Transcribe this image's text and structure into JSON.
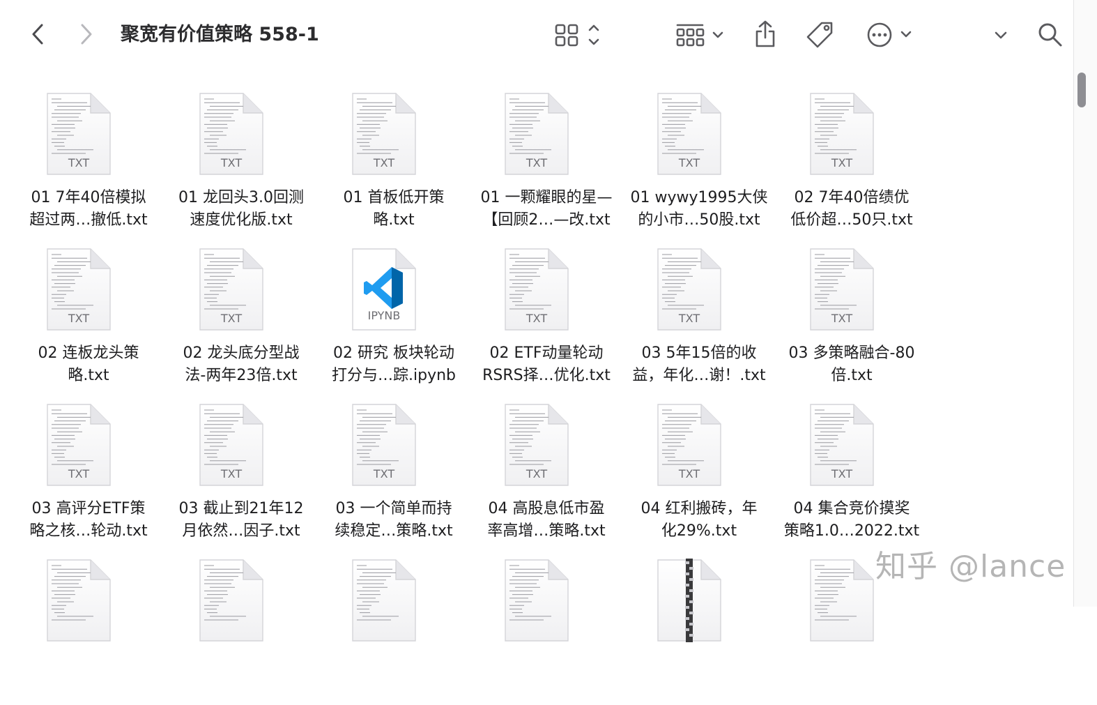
{
  "window": {
    "title": "聚宽有价值策略 558-1"
  },
  "toolbar": {
    "back_icon": "chevron-left-icon",
    "forward_icon": "chevron-right-icon",
    "view_icon": "grid-view-icon",
    "group_icon": "group-by-icon",
    "share_icon": "share-icon",
    "tag_icon": "tag-icon",
    "more_icon": "ellipsis-circle-icon",
    "search_icon": "search-icon"
  },
  "files": [
    {
      "line1": "01 7年40倍模拟",
      "line2": "超过两…撤低.txt",
      "kind": "txt",
      "ext": "TXT"
    },
    {
      "line1": "01 龙回头3.0回测",
      "line2": "速度优化版.txt",
      "kind": "txt",
      "ext": "TXT"
    },
    {
      "line1": "01 首板低开策",
      "line2": "略.txt",
      "kind": "txt",
      "ext": "TXT"
    },
    {
      "line1": "01 一颗耀眼的星—",
      "line2": "【回顾2…—改.txt",
      "kind": "txt",
      "ext": "TXT"
    },
    {
      "line1": "01 wywy1995大侠",
      "line2": "的小市…50股.txt",
      "kind": "txt",
      "ext": "TXT"
    },
    {
      "line1": "02 7年40倍绩优",
      "line2": "低价超…50只.txt",
      "kind": "txt",
      "ext": "TXT"
    },
    {
      "line1": "02 连板龙头策",
      "line2": "略.txt",
      "kind": "txt",
      "ext": "TXT"
    },
    {
      "line1": "02 龙头底分型战",
      "line2": "法-两年23倍.txt",
      "kind": "txt",
      "ext": "TXT"
    },
    {
      "line1": "02 研究 板块轮动",
      "line2": "打分与…踪.ipynb",
      "kind": "ipynb",
      "ext": "IPYNB"
    },
    {
      "line1": "02 ETF动量轮动",
      "line2": "RSRS择…优化.txt",
      "kind": "txt",
      "ext": "TXT"
    },
    {
      "line1": "03 5年15倍的收",
      "line2": "益，年化…谢！.txt",
      "kind": "txt",
      "ext": "TXT"
    },
    {
      "line1": "03 多策略融合-80",
      "line2": "倍.txt",
      "kind": "txt",
      "ext": "TXT"
    },
    {
      "line1": "03 高评分ETF策",
      "line2": "略之核…轮动.txt",
      "kind": "txt",
      "ext": "TXT"
    },
    {
      "line1": "03 截止到21年12",
      "line2": "月依然…因子.txt",
      "kind": "txt",
      "ext": "TXT"
    },
    {
      "line1": "03 一个简单而持",
      "line2": "续稳定…策略.txt",
      "kind": "txt",
      "ext": "TXT"
    },
    {
      "line1": "04 高股息低市盈",
      "line2": "率高增…策略.txt",
      "kind": "txt",
      "ext": "TXT"
    },
    {
      "line1": "04 红利搬砖，年",
      "line2": "化29%.txt",
      "kind": "txt",
      "ext": "TXT"
    },
    {
      "line1": "04 集合竞价摸奖",
      "line2": "策略1.0…2022.txt",
      "kind": "txt",
      "ext": "TXT"
    },
    {
      "line1": "",
      "line2": "",
      "kind": "txt",
      "ext": ""
    },
    {
      "line1": "",
      "line2": "",
      "kind": "txt",
      "ext": ""
    },
    {
      "line1": "",
      "line2": "",
      "kind": "txt",
      "ext": ""
    },
    {
      "line1": "",
      "line2": "",
      "kind": "txt",
      "ext": ""
    },
    {
      "line1": "",
      "line2": "",
      "kind": "zip",
      "ext": ""
    },
    {
      "line1": "",
      "line2": "",
      "kind": "txt",
      "ext": ""
    }
  ],
  "watermark": "知乎 @lance",
  "colors": {
    "accent": "#0065a9",
    "vscode_blue": "#1f9cf0",
    "text": "#1d1d1f",
    "icon": "#6e6e73"
  }
}
